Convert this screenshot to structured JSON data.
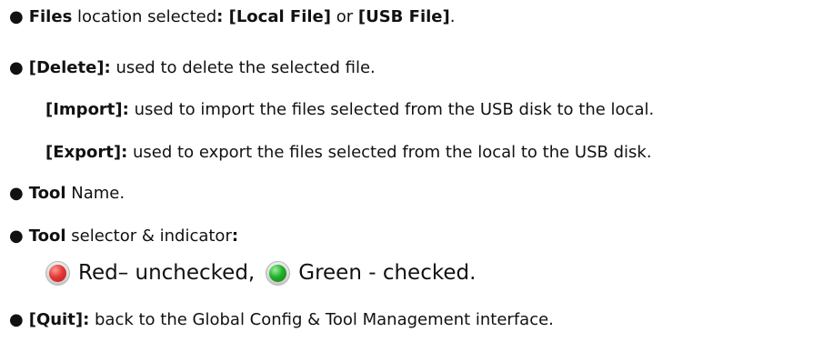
{
  "items": [
    {
      "bullet": "●",
      "b1": "Files",
      "t1": " location selected",
      "b2": ": [Local File]",
      "t2": " or ",
      "b3": "[USB File]",
      "t3": "."
    },
    {
      "bullet": "●",
      "b1": "[Delete]:",
      "t1": " used to delete the selected file."
    },
    {
      "b1": "[Import]:",
      "t1": " used to import the files selected from the USB disk to the local."
    },
    {
      "b1": "[Export]:",
      "t1": " used to export the files selected from the local to the USB disk."
    },
    {
      "bullet": "●",
      "b1": "Tool",
      "t1": " Name."
    },
    {
      "bullet": "●",
      "b1": "Tool",
      "t1": " selector & indicator",
      "b2": ":"
    },
    {
      "bullet": "●",
      "b1": "[Quit]:",
      "t1": " back to the Global Config & Tool Management interface."
    }
  ],
  "legend": {
    "red_label": "Red– unchecked,",
    "green_label": "Green - checked.",
    "red_icon": "red-indicator-icon",
    "green_icon": "green-indicator-icon",
    "red_color": "#e53935",
    "green_color": "#22b02a"
  }
}
